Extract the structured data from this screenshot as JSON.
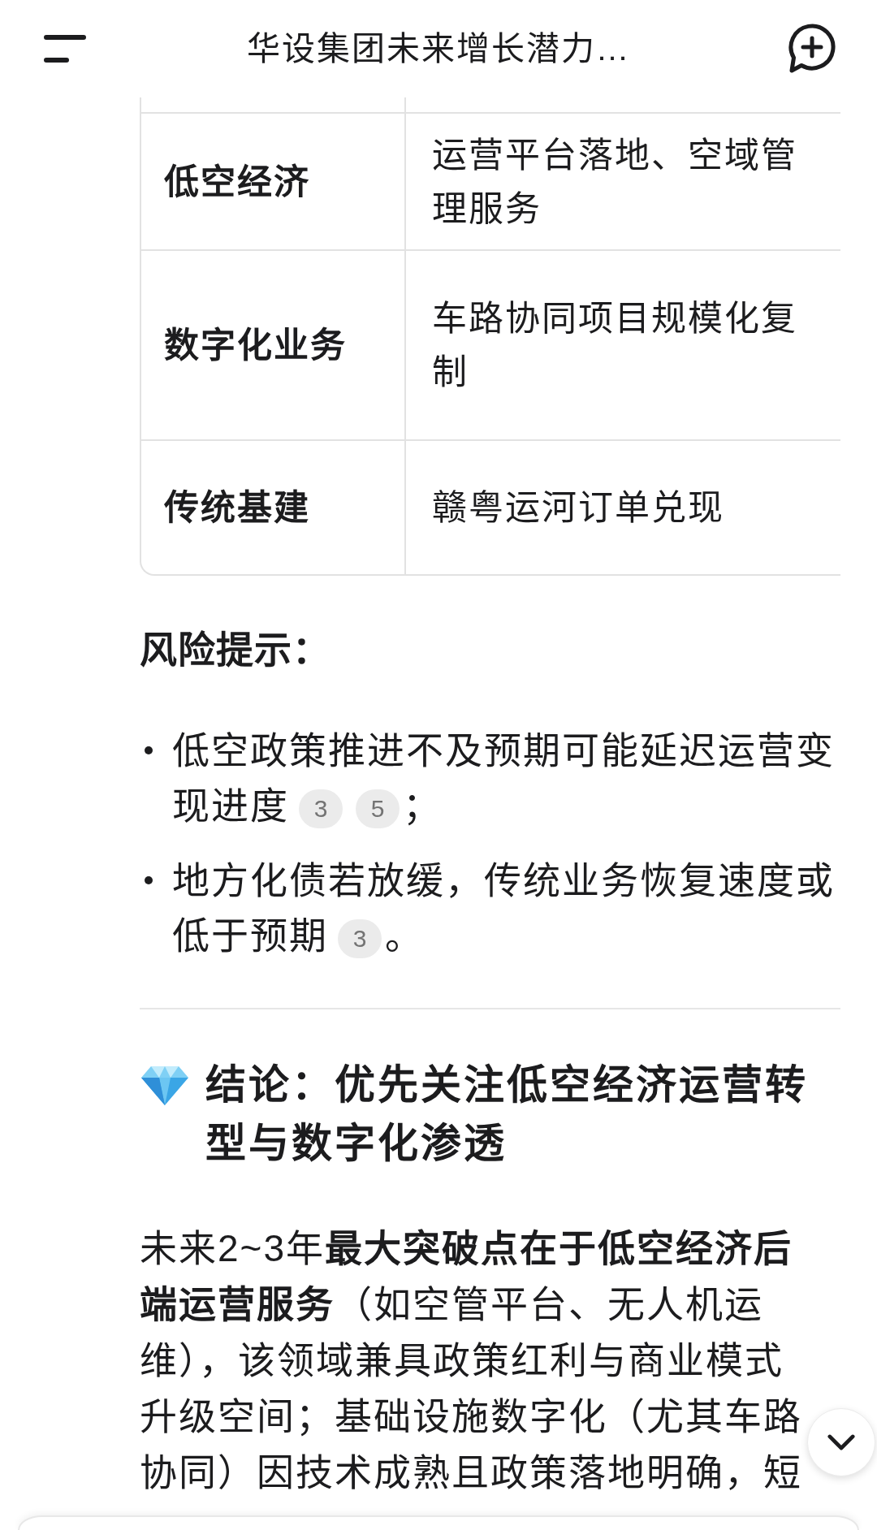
{
  "header": {
    "title": "华设集团未来增长潜力…"
  },
  "table": {
    "rows": [
      {
        "cells": [
          "低空经济",
          "运营平台落地、空域管理服务"
        ]
      },
      {
        "cells": [
          "数字化业务",
          "车路协同项目规模化复制"
        ]
      },
      {
        "cells": [
          "传统基建",
          "赣粤运河订单兑现"
        ]
      }
    ]
  },
  "risks": {
    "heading": "风险提示：",
    "items": [
      {
        "text": "低空政策推进不及预期可能延迟运营变现进度",
        "citations": [
          "3",
          "5"
        ],
        "end": "；"
      },
      {
        "text": "地方化债若放缓，传统业务恢复速度或低于预期",
        "citations": [
          "3"
        ],
        "end": "。"
      }
    ]
  },
  "conclusion": {
    "heading": "结论：优先关注低空经济运营转型与数字化渗透",
    "paragraph": "未来2~3年**最大突破点在于低空经济后端运营服务**（如空管平台、无人机运维），该领域兼具政策红利与商业模式升级空间；基础设施数字化（尤其车路协同）因技术成熟且政策落地明确，短"
  }
}
